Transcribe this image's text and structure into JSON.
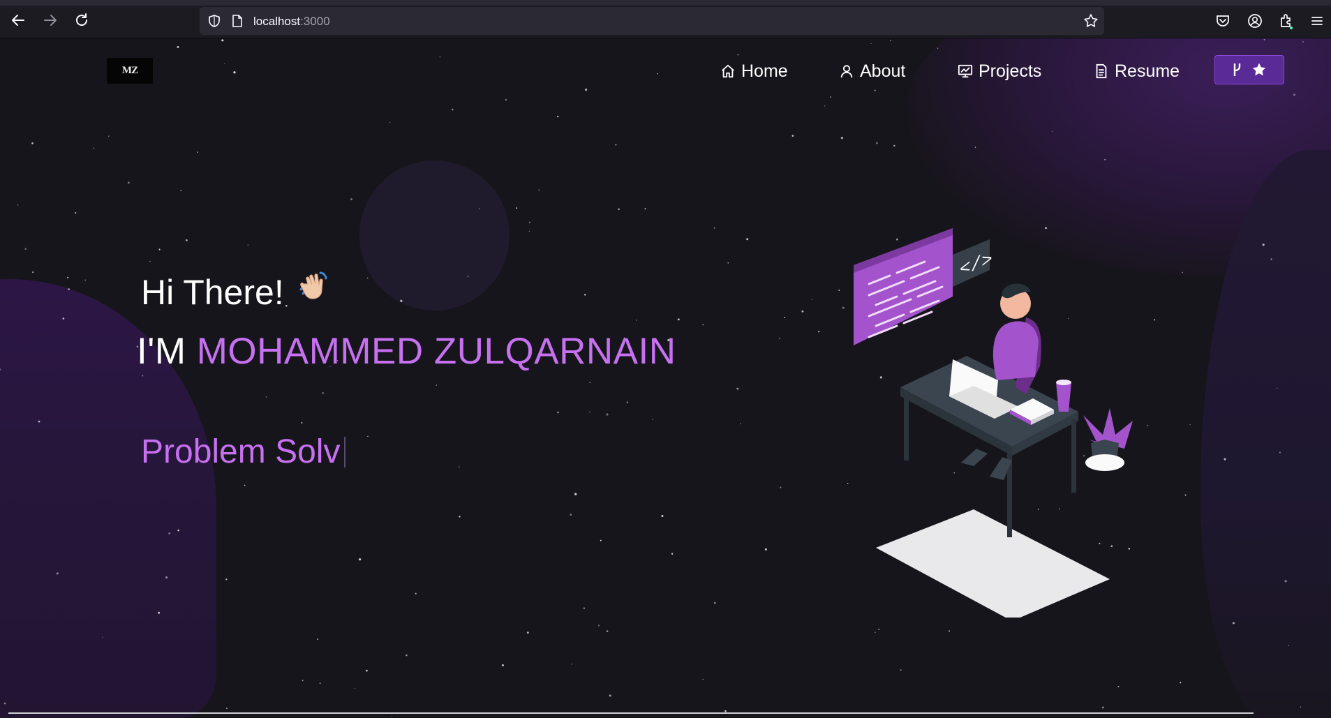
{
  "browser": {
    "url_host": "localhost",
    "url_port": ":3000",
    "icons": [
      "back-arrow-icon",
      "forward-arrow-icon",
      "reload-icon",
      "shield-icon",
      "page-icon",
      "bookmark-star-icon",
      "pocket-icon",
      "account-icon",
      "extensions-icon",
      "menu-icon"
    ]
  },
  "navbar": {
    "logo_text": "MZ",
    "items": [
      {
        "label": "Home",
        "icon": "home-icon"
      },
      {
        "label": "About",
        "icon": "user-icon"
      },
      {
        "label": "Projects",
        "icon": "projects-icon"
      },
      {
        "label": "Resume",
        "icon": "document-icon"
      }
    ],
    "github_button": {
      "icons": [
        "fork-icon",
        "star-icon"
      ]
    }
  },
  "hero": {
    "greeting": "Hi There!",
    "wave_emoji": "👋🏻",
    "name_prefix": "I'M",
    "name": "MOHAMMED ZULQARNAIN",
    "typewriter_text": "Problem Solv"
  },
  "colors": {
    "accent": "#c770f0",
    "background": "#17151c",
    "button_bg": "#5a2b97"
  }
}
